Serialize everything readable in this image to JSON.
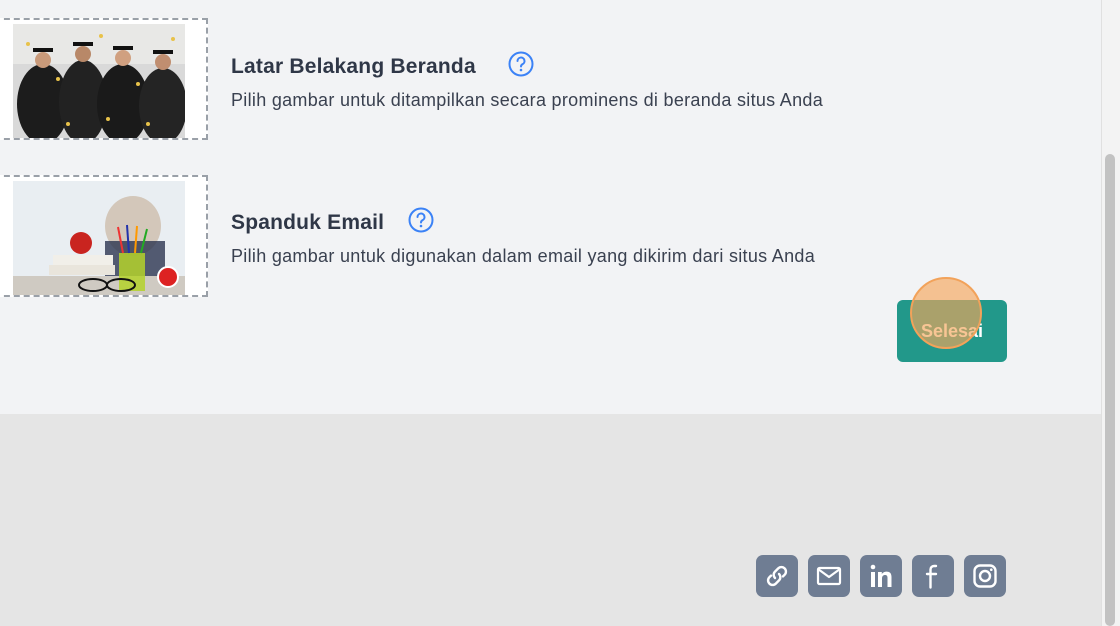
{
  "settings": [
    {
      "title": "Latar Belakang Beranda",
      "description": "Pilih gambar untuk ditampilkan secara prominens di beranda situs Anda"
    },
    {
      "title": "Spanduk Email",
      "description": "Pilih gambar untuk digunakan dalam email yang dikirim dari situs Anda"
    }
  ],
  "done_button": {
    "label": "Selesai"
  },
  "footer": {
    "social_icons": [
      "link-icon",
      "mail-icon",
      "linkedin-icon",
      "facebook-icon",
      "instagram-icon"
    ]
  },
  "colors": {
    "accent": "#22988a",
    "help_icon": "#3b82f6",
    "social_bg": "#6f7d93",
    "click_ring": "#f2a25a"
  }
}
